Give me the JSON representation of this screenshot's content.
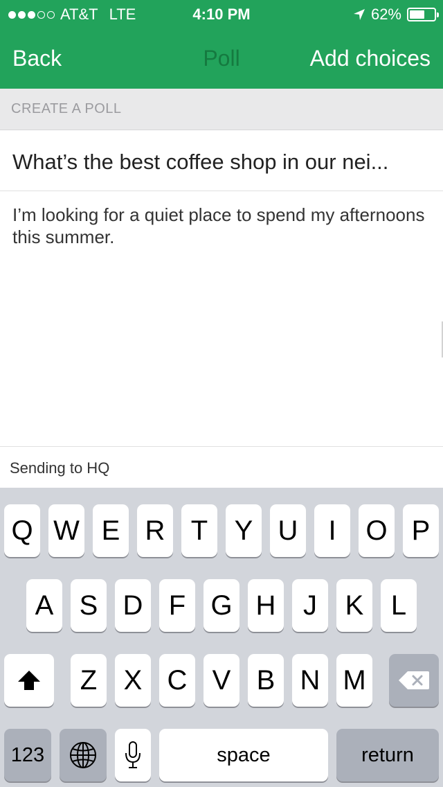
{
  "status_bar": {
    "carrier": "AT&T",
    "network": "LTE",
    "time": "4:10 PM",
    "battery_percent": "62%",
    "battery_level": 0.62,
    "signal_bars_filled": 3,
    "signal_bars_total": 5
  },
  "nav": {
    "back_label": "Back",
    "title": "Poll",
    "action_label": "Add choices"
  },
  "section_header": "CREATE A POLL",
  "poll": {
    "question": "What’s the best coffee shop in our nei...",
    "description": "I’m looking for a quiet place to spend my afternoons this summer."
  },
  "recipient": "Sending to HQ",
  "keyboard": {
    "row1": [
      "Q",
      "W",
      "E",
      "R",
      "T",
      "Y",
      "U",
      "I",
      "O",
      "P"
    ],
    "row2": [
      "A",
      "S",
      "D",
      "F",
      "G",
      "H",
      "J",
      "K",
      "L"
    ],
    "row3": [
      "Z",
      "X",
      "C",
      "V",
      "B",
      "N",
      "M"
    ],
    "numbers_label": "123",
    "space_label": "space",
    "return_label": "return"
  },
  "colors": {
    "brand": "#22a35b",
    "nav_title": "#157a40"
  }
}
